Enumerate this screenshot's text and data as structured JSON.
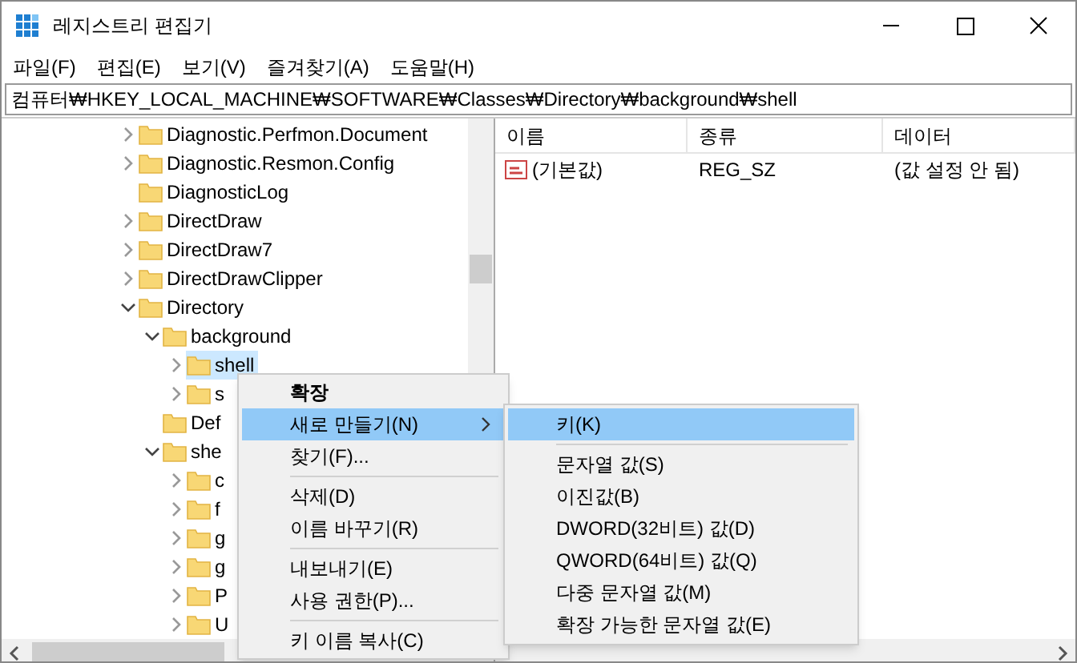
{
  "window": {
    "title": "레지스트리 편집기"
  },
  "menu_bar": [
    "파일(F)",
    "편집(E)",
    "보기(V)",
    "즐겨찾기(A)",
    "도움말(H)"
  ],
  "address": "컴퓨터₩HKEY_LOCAL_MACHINE₩SOFTWARE₩Classes₩Directory₩background₩shell",
  "tree": [
    {
      "label": "Diagnostic.Perfmon.Document",
      "kind": "node",
      "expanded": false,
      "selected": false
    },
    {
      "label": "Diagnostic.Resmon.Config",
      "kind": "node",
      "expanded": false,
      "selected": false
    },
    {
      "label": "DiagnosticLog",
      "kind": "leaf",
      "selected": false
    },
    {
      "label": "DirectDraw",
      "kind": "node",
      "expanded": false,
      "selected": false
    },
    {
      "label": "DirectDraw7",
      "kind": "node",
      "expanded": false,
      "selected": false
    },
    {
      "label": "DirectDrawClipper",
      "kind": "node",
      "expanded": false,
      "selected": false
    },
    {
      "label": "Directory",
      "kind": "node",
      "expanded": true,
      "selected": false,
      "children": [
        {
          "label": "background",
          "kind": "node",
          "expanded": true,
          "selected": false,
          "children": [
            {
              "label": "shell",
              "kind": "node",
              "expanded": false,
              "selected": true
            },
            {
              "label": "s",
              "kind": "node",
              "expanded": false,
              "selected": false
            }
          ]
        },
        {
          "label": "Def",
          "kind": "leaf",
          "selected": false
        },
        {
          "label": "she",
          "kind": "node",
          "expanded": true,
          "selected": false,
          "children": [
            {
              "label": "c",
              "kind": "node",
              "expanded": false,
              "selected": false
            },
            {
              "label": "f",
              "kind": "node",
              "expanded": false,
              "selected": false
            },
            {
              "label": "g",
              "kind": "node",
              "expanded": false,
              "selected": false
            },
            {
              "label": "g",
              "kind": "node",
              "expanded": false,
              "selected": false
            },
            {
              "label": "P",
              "kind": "node",
              "expanded": false,
              "selected": false
            },
            {
              "label": "U",
              "kind": "node",
              "expanded": false,
              "selected": false
            }
          ]
        }
      ]
    }
  ],
  "values": {
    "columns": [
      "이름",
      "종류",
      "데이터"
    ],
    "rows": [
      {
        "name": "(기본값)",
        "type": "REG_SZ",
        "data": "(값 설정 안 됨)"
      }
    ]
  },
  "context_menu": [
    {
      "kind": "default",
      "label": "확장",
      "selected": false
    },
    {
      "kind": "submenu",
      "label": "새로 만들기(N)",
      "selected": true
    },
    {
      "kind": "item",
      "label": "찾기(F)...",
      "selected": false
    },
    {
      "kind": "separator"
    },
    {
      "kind": "item",
      "label": "삭제(D)",
      "selected": false
    },
    {
      "kind": "item",
      "label": "이름 바꾸기(R)",
      "selected": false
    },
    {
      "kind": "separator"
    },
    {
      "kind": "item",
      "label": "내보내기(E)",
      "selected": false
    },
    {
      "kind": "item",
      "label": "사용 권한(P)...",
      "selected": false
    },
    {
      "kind": "separator"
    },
    {
      "kind": "item",
      "label": "키 이름 복사(C)",
      "selected": false
    }
  ],
  "submenu": [
    {
      "kind": "item",
      "label": "키(K)",
      "selected": true
    },
    {
      "kind": "separator"
    },
    {
      "kind": "item",
      "label": "문자열 값(S)",
      "selected": false
    },
    {
      "kind": "item",
      "label": "이진값(B)",
      "selected": false
    },
    {
      "kind": "item",
      "label": "DWORD(32비트) 값(D)",
      "selected": false
    },
    {
      "kind": "item",
      "label": "QWORD(64비트) 값(Q)",
      "selected": false
    },
    {
      "kind": "item",
      "label": "다중 문자열 값(M)",
      "selected": false
    },
    {
      "kind": "item",
      "label": "확장 가능한 문자열 값(E)",
      "selected": false
    }
  ]
}
